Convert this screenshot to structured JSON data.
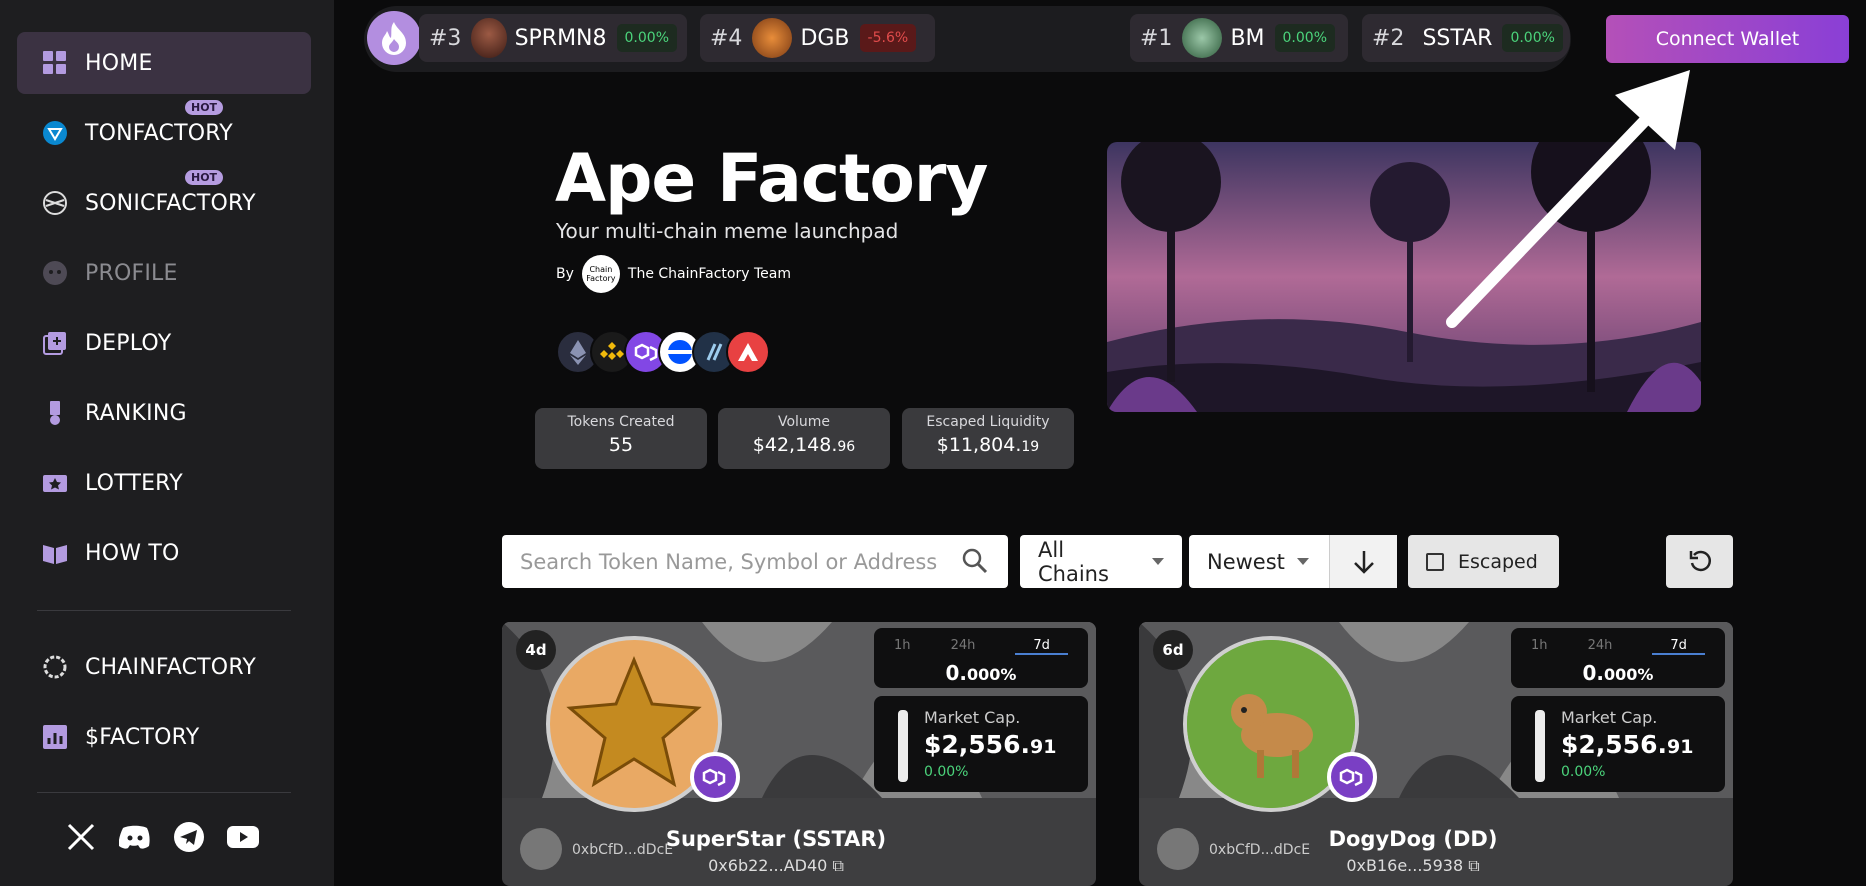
{
  "sidebar": {
    "items": [
      {
        "label": "HOME",
        "icon": "grid-icon"
      },
      {
        "label": "TONFACTORY",
        "icon": "ton-icon",
        "badge": "HOT"
      },
      {
        "label": "SONICFACTORY",
        "icon": "sonic-icon",
        "badge": "HOT"
      },
      {
        "label": "PROFILE",
        "icon": "profile-icon"
      },
      {
        "label": "DEPLOY",
        "icon": "deploy-icon"
      },
      {
        "label": "RANKING",
        "icon": "ranking-icon"
      },
      {
        "label": "LOTTERY",
        "icon": "ticket-icon"
      },
      {
        "label": "HOW TO",
        "icon": "book-icon"
      },
      {
        "label": "CHAINFACTORY",
        "icon": "chainfactory-icon"
      },
      {
        "label": "$FACTORY",
        "icon": "chart-icon"
      }
    ]
  },
  "ticker": [
    {
      "rank": "#3",
      "symbol": "SPRMN8",
      "pct": "0.00%"
    },
    {
      "rank": "#4",
      "symbol": "DGB",
      "pct": "-5.6%"
    },
    {
      "rank": "#1",
      "symbol": "BM",
      "pct": "0.00%"
    },
    {
      "rank": "#2",
      "symbol": "SSTAR",
      "pct": "0.00%"
    }
  ],
  "header": {
    "connect_label": "Connect Wallet"
  },
  "hero": {
    "title": "Ape Factory",
    "subtitle": "Your multi-chain meme launchpad",
    "by": "By",
    "team": "The ChainFactory Team",
    "logo_text": "Chain Factory"
  },
  "stats": [
    {
      "label": "Tokens Created",
      "value": "55",
      "cents": ""
    },
    {
      "label": "Volume",
      "value": "$42,148.",
      "cents": "96"
    },
    {
      "label": "Escaped Liquidity",
      "value": "$11,804.",
      "cents": "19"
    }
  ],
  "filters": {
    "search_placeholder": "Search Token Name, Symbol or Address",
    "chains": "All Chains",
    "sort": "Newest",
    "escaped": "Escaped"
  },
  "cards": [
    {
      "age": "4d",
      "tabs": [
        "1h",
        "24h",
        "7d"
      ],
      "pct": "0.",
      "pct_small": "000%",
      "mcap_label": "Market Cap.",
      "mcap": "$2,556.",
      "mcap_cents": "91",
      "delta": "0.00%",
      "creator": "0xbCfD...dDcE",
      "name": "SuperStar (SSTAR)",
      "address": "0x6b22...AD40"
    },
    {
      "age": "6d",
      "tabs": [
        "1h",
        "24h",
        "7d"
      ],
      "pct": "0.",
      "pct_small": "000%",
      "mcap_label": "Market Cap.",
      "mcap": "$2,556.",
      "mcap_cents": "91",
      "delta": "0.00%",
      "creator": "0xbCfD...dDcE",
      "name": "DogyDog (DD)",
      "address": "0xB16e...5938"
    }
  ]
}
